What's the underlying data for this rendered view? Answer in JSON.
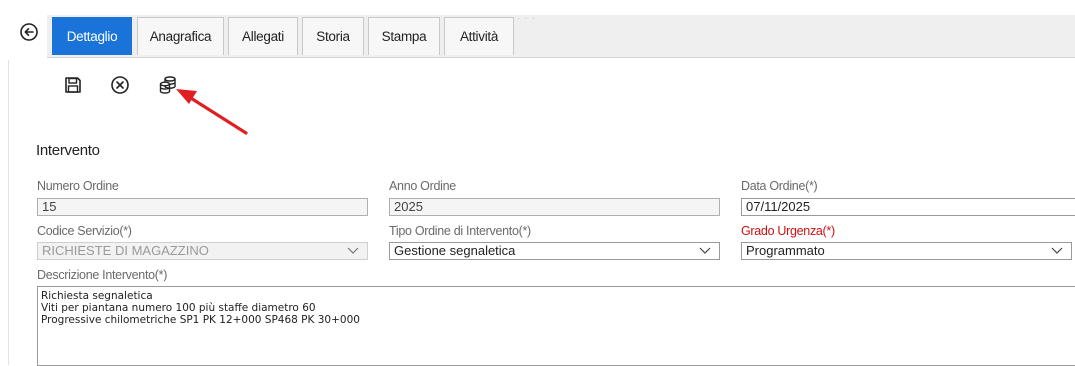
{
  "tabs": [
    {
      "label": "Dettaglio",
      "active": true
    },
    {
      "label": "Anagrafica",
      "active": false
    },
    {
      "label": "Allegati",
      "active": false
    },
    {
      "label": "Storia",
      "active": false
    },
    {
      "label": "Stampa",
      "active": false
    },
    {
      "label": "Attività",
      "active": false
    }
  ],
  "toolbar": {
    "icons": [
      "save-icon",
      "cancel-icon",
      "database-icon"
    ]
  },
  "section": {
    "title": "Intervento"
  },
  "form": {
    "numero_ordine": {
      "label": "Numero Ordine",
      "value": "15"
    },
    "anno_ordine": {
      "label": "Anno Ordine",
      "value": "2025"
    },
    "data_ordine": {
      "label": "Data Ordine(*)",
      "value": "07/11/2025"
    },
    "codice_servizio": {
      "label": "Codice Servizio(*)",
      "value": "RICHIESTE DI MAGAZZINO"
    },
    "tipo_ordine": {
      "label": "Tipo Ordine di Intervento(*)",
      "value": "Gestione segnaletica"
    },
    "grado_urgenza": {
      "label": "Grado Urgenza(*)",
      "value": "Programmato"
    },
    "descrizione": {
      "label": "Descrizione Intervento(*)",
      "lines": [
        "Richiesta segnaletica",
        "Viti per piantana numero 100 più staffe diametro 60",
        "Progressive chilometriche SP1 PK 12+000 SP468 PK 30+000"
      ]
    }
  },
  "colors": {
    "tab_active": "#1a73d9",
    "required_label": "#d01010",
    "arrow": "#e02020"
  }
}
